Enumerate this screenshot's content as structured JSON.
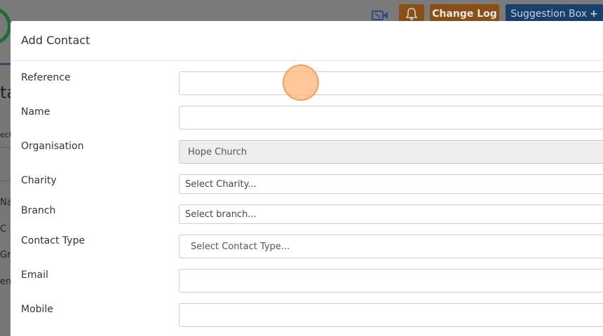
{
  "background": {
    "heading_fragment": "ta",
    "side_fragments": [
      "ect",
      "Na",
      "C",
      "Gr",
      "ent"
    ]
  },
  "topbar": {
    "video_icon": "video-camera-icon",
    "bell_icon": "bell-icon",
    "changelog_label": "Change Log",
    "suggestion_label": "Suggestion Box",
    "suggestion_icon": "plus-icon"
  },
  "modal": {
    "title": "Add Contact",
    "fields": {
      "reference": {
        "label": "Reference",
        "value": ""
      },
      "name": {
        "label": "Name",
        "value": ""
      },
      "organisation": {
        "label": "Organisation",
        "value": "Hope Church"
      },
      "charity": {
        "label": "Charity",
        "placeholder": "Select Charity..."
      },
      "branch": {
        "label": "Branch",
        "placeholder": "Select branch..."
      },
      "contact_type": {
        "label": "Contact Type",
        "placeholder": "Select Contact Type..."
      },
      "email": {
        "label": "Email",
        "value": ""
      },
      "mobile": {
        "label": "Mobile",
        "value": ""
      }
    }
  },
  "colors": {
    "changelog_bg": "#8a4f15",
    "suggestion_bg": "#18406a",
    "click_marker": "#ffb478"
  }
}
